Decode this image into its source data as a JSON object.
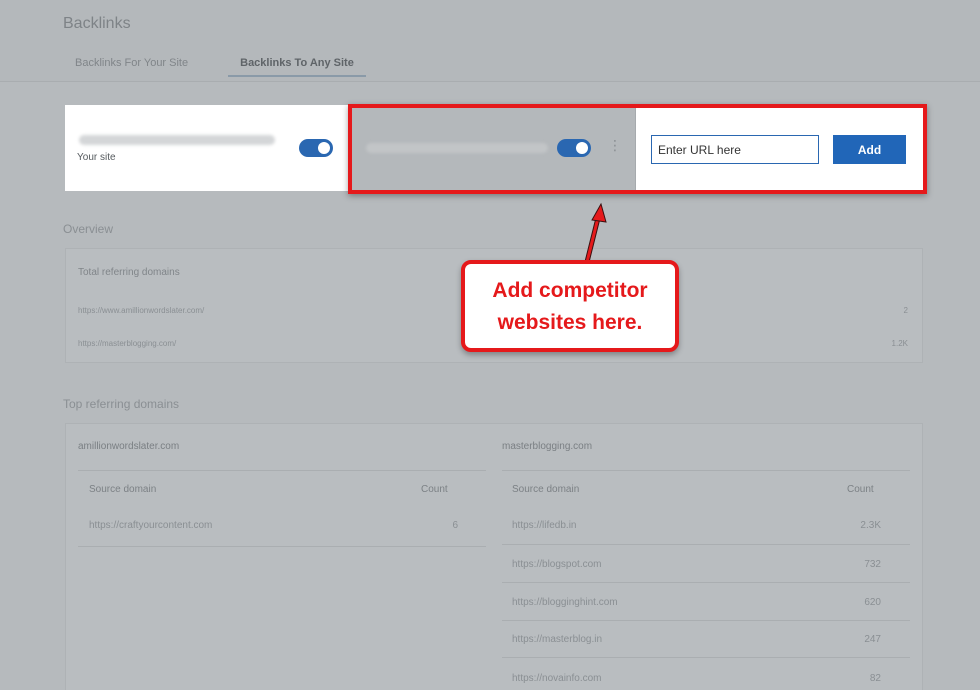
{
  "page": {
    "title": "Backlinks"
  },
  "tabs": [
    {
      "label": "Backlinks For Your Site",
      "active": false
    },
    {
      "label": "Backlinks To Any Site",
      "active": true
    }
  ],
  "sites": {
    "your_site_label": "Your site",
    "add_input_placeholder": "Enter URL here",
    "add_button_label": "Add",
    "kebab_glyph": "⋮"
  },
  "overview": {
    "section_label": "Overview",
    "panel_title": "Total referring domains",
    "rows": [
      {
        "domain": "https://www.amillionwordslater.com/",
        "value": "2"
      },
      {
        "domain": "https://masterblogging.com/",
        "value": "1.2K"
      }
    ]
  },
  "top_referring": {
    "section_label": "Top referring domains",
    "left": {
      "title": "amillionwordslater.com",
      "col_source": "Source domain",
      "col_count": "Count",
      "rows": [
        {
          "domain": "https://craftyourcontent.com",
          "count": "6"
        }
      ]
    },
    "right": {
      "title": "masterblogging.com",
      "col_source": "Source domain",
      "col_count": "Count",
      "rows": [
        {
          "domain": "https://lifedb.in",
          "count": "2.3K"
        },
        {
          "domain": "https://blogspot.com",
          "count": "732"
        },
        {
          "domain": "https://blogginghint.com",
          "count": "620"
        },
        {
          "domain": "https://masterblog.in",
          "count": "247"
        },
        {
          "domain": "https://novainfo.com",
          "count": "82"
        }
      ]
    }
  },
  "annotation": {
    "line1": "Add competitor",
    "line2": "websites here."
  },
  "colors": {
    "accent": "#2166b8",
    "highlight": "#e5191b"
  }
}
